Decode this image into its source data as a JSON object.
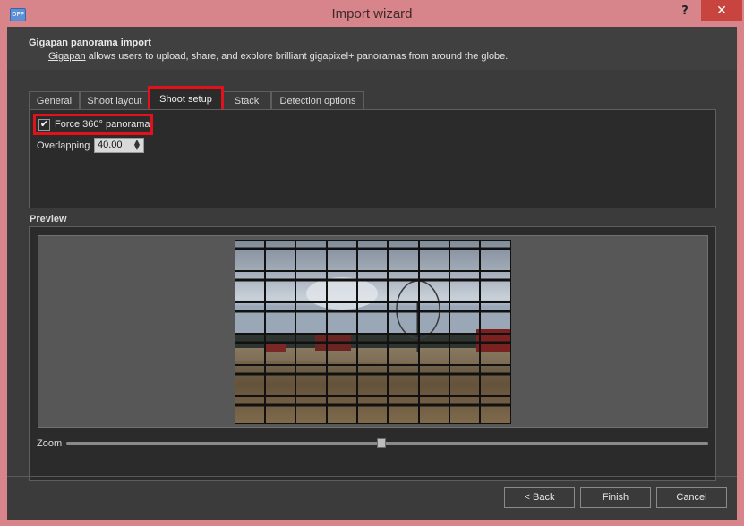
{
  "window": {
    "title": "Import wizard",
    "app_icon": "DPP",
    "help": "?",
    "close": "✕"
  },
  "header": {
    "title": "Gigapan panorama import",
    "link": "Gigapan",
    "description": " allows users to upload, share, and explore brilliant gigapixel+ panoramas from around the globe."
  },
  "tabs": [
    {
      "label": "General"
    },
    {
      "label": "Shoot layout"
    },
    {
      "label": "Shoot setup",
      "active": true
    },
    {
      "label": "Stack"
    },
    {
      "label": "Detection options"
    }
  ],
  "shoot_setup": {
    "force_360_label": "Force 360° panorama",
    "force_360_checked": true,
    "check_glyph": "✔",
    "overlapping_label": "Overlapping",
    "overlapping_value": "40.00"
  },
  "preview": {
    "label": "Preview",
    "grid_columns": 9,
    "grid_rows": 8
  },
  "zoom": {
    "label": "Zoom",
    "level": 0.49
  },
  "buttons": {
    "back": "< Back",
    "finish": "Finish",
    "cancel": "Cancel"
  },
  "colors": {
    "highlight": "#e0121c",
    "titlebar": "#d7848a",
    "close": "#c7453e"
  }
}
